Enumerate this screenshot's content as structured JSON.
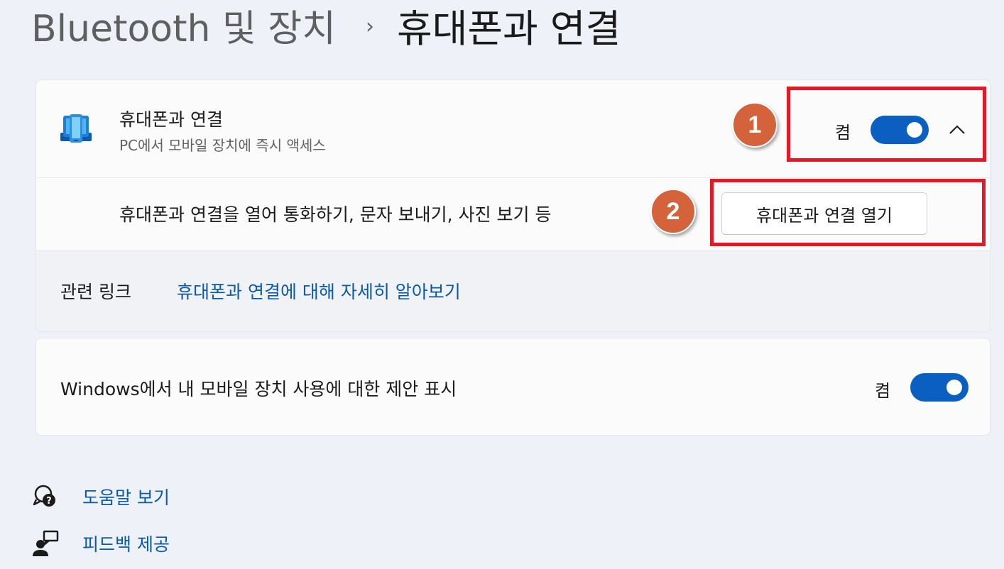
{
  "breadcrumb": {
    "parent": "Bluetooth 및 장치",
    "separator": "›",
    "current": "휴대폰과 연결"
  },
  "phone_link": {
    "title": "휴대폰과 연결",
    "subtitle": "PC에서 모바일 장치에 즉시 액세스",
    "state_label": "켬",
    "toggle_on": true,
    "expanded": true,
    "detail_text": "휴대폰과 연결을 열어 통화하기, 문자 보내기, 사진 보기 등",
    "open_button_label": "휴대폰과 연결 열기"
  },
  "related_links": {
    "label": "관련 링크",
    "link_text": "휴대폰과 연결에 대해 자세히 알아보기"
  },
  "suggestions": {
    "text": "Windows에서 내 모바일 장치 사용에 대한 제안 표시",
    "state_label": "켬",
    "toggle_on": true
  },
  "help_links": {
    "get_help": "도움말 보기",
    "give_feedback": "피드백 제공"
  },
  "annotations": {
    "badge_1": "1",
    "badge_2": "2",
    "highlight_color": "#e21a27",
    "badge_color": "#d4623b"
  },
  "colors": {
    "accent": "#0a5fc0",
    "link": "#0a5aa8",
    "background": "#eef2f8"
  }
}
